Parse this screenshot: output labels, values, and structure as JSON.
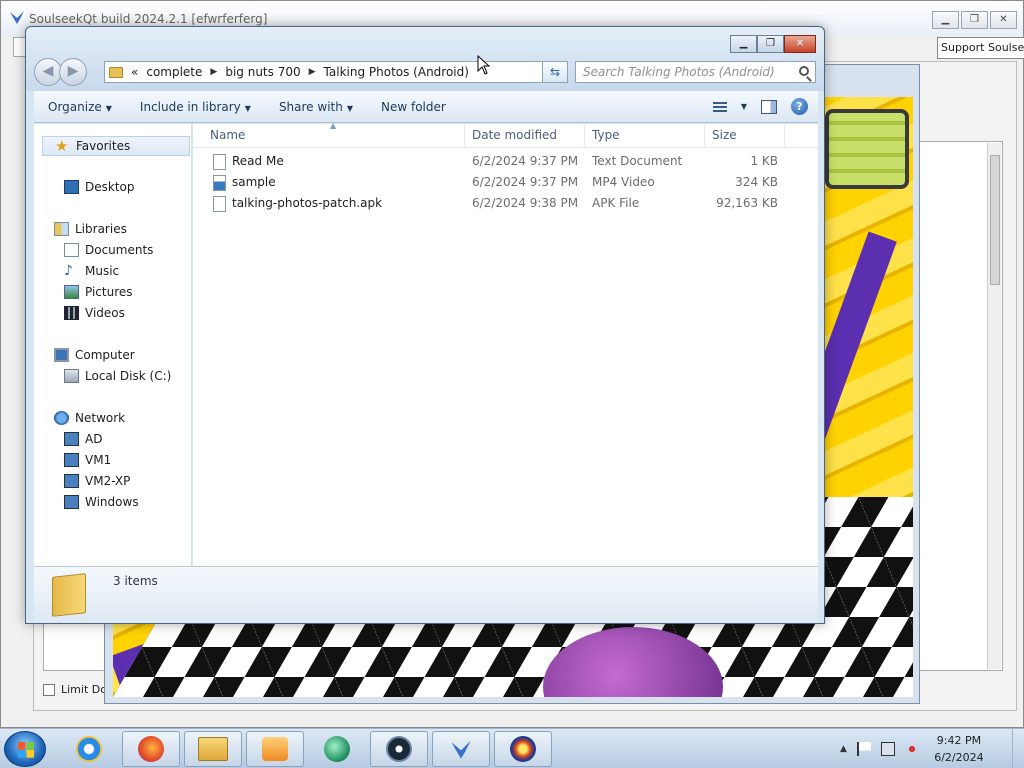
{
  "background_app": {
    "title": "SoulseekQt build 2024.2.1 [efwrferferg]",
    "support_button": "Support Soulseek",
    "limit_checkbox_label": "Limit Dow"
  },
  "explorer": {
    "breadcrumb": {
      "overflow": "«",
      "items": [
        "complete",
        "big nuts 700",
        "Talking Photos (Android)"
      ]
    },
    "search_placeholder": "Search Talking Photos (Android)",
    "toolbar": {
      "organize": "Organize",
      "include_in_library": "Include in library",
      "share_with": "Share with",
      "new_folder": "New folder"
    },
    "nav": {
      "favorites": "Favorites",
      "desktop": "Desktop",
      "libraries": "Libraries",
      "documents": "Documents",
      "music": "Music",
      "pictures": "Pictures",
      "videos": "Videos",
      "computer": "Computer",
      "local_disk": "Local Disk (C:)",
      "network": "Network",
      "net_items": [
        "AD",
        "VM1",
        "VM2-XP",
        "Windows"
      ]
    },
    "columns": {
      "name": "Name",
      "date_modified": "Date modified",
      "type": "Type",
      "size": "Size"
    },
    "files": [
      {
        "name": "Read Me",
        "date": "6/2/2024 9:37 PM",
        "type": "Text Document",
        "size": "1 KB",
        "icon": "text-file-icon"
      },
      {
        "name": "sample",
        "date": "6/2/2024 9:37 PM",
        "type": "MP4 Video",
        "size": "324 KB",
        "icon": "video-file-icon"
      },
      {
        "name": "talking-photos-patch.apk",
        "date": "6/2/2024 9:38 PM",
        "type": "APK File",
        "size": "92,163 KB",
        "icon": "generic-file-icon"
      }
    ],
    "status": {
      "items_count": "3 items"
    }
  },
  "taskbar": {
    "apps": [
      "internet-explorer",
      "firefox",
      "windows-explorer",
      "media-player",
      "green-app",
      "steam",
      "soulseek",
      "burst-app"
    ],
    "clock": {
      "time": "9:42 PM",
      "date": "6/2/2024"
    },
    "tray_up_arrow": "▲"
  },
  "colors": {
    "explorer_frame": "#d8e6f4",
    "taskbar": "#b6cbe2",
    "close_button": "#c7432a"
  }
}
